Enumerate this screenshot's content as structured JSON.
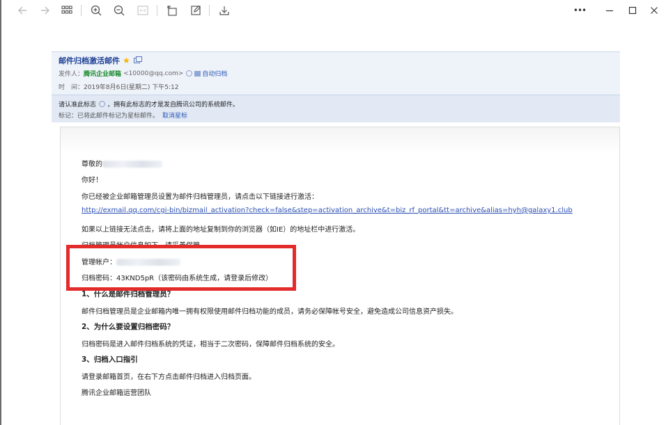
{
  "toolbar": {
    "buttons": [
      "back",
      "forward",
      "grid",
      "zoom-in",
      "zoom-out",
      "fit",
      "rotate",
      "edit",
      "download",
      "more",
      "minimize",
      "maximize",
      "close"
    ],
    "more_label": "•••"
  },
  "mail": {
    "subject": "邮件归档激活邮件",
    "sender_label": "发件人：",
    "sender_name": "腾讯企业邮箱",
    "sender_email": "<10000@qq.com>",
    "archive_label": "自动归档",
    "time_label": "时　间：",
    "time_value": "2019年8月6日(星期二) 下午5:12",
    "notice_text_1": "请认准此标志",
    "notice_text_2": "，拥有此标志的才是发自腾讯公司的系统邮件。",
    "flag_text": "标记：已将此邮件标记为星标邮件。",
    "flag_cancel": "取消星标"
  },
  "body": {
    "greeting": "尊敬的",
    "hello": "你好！",
    "intro": "你已经被企业邮箱管理员设置为邮件归档管理员，请点击以下链接进行激活：",
    "url": "http://exmail.qq.com/cgi-bin/bizmail_activation?check=false&step=activation_archive&t=biz_rf_portal&tt=archive&alias=hyh@galaxy1.club",
    "copy_hint": "如果以上链接无法点击，请将上面的地址复制到你的浏览器（如IE）的地址栏中进行激活。",
    "account_info": "归档管理员帐户信息如下，请妥善保管。",
    "account_label": "管理帐户：",
    "password_line": "归档密码：43KND5pR（该密码由系统生成，请登录后修改）",
    "q1_title": "1、什么是邮件归档管理员？",
    "q1_text": "邮件归档管理员是企业邮箱内唯一拥有权限使用邮件归档功能的成员，请务必保障帐号安全，避免造成公司信息资产损失。",
    "q2_title": "2、为什么要设置归档密码？",
    "q2_text": "归档密码是进入邮件归档系统的凭证，相当于二次密码，保障邮件归档系统的安全。",
    "q3_title": "3、归档入口指引",
    "q3_text": "请登录邮箱首页，在右下方点击邮件归档进入归档页面。",
    "signature": "腾讯企业邮箱运营团队"
  },
  "colors": {
    "highlight": "#e32b2b",
    "header_bg": "#eef2f9",
    "link": "#2b4fb3",
    "sender": "#1d8a2e"
  }
}
